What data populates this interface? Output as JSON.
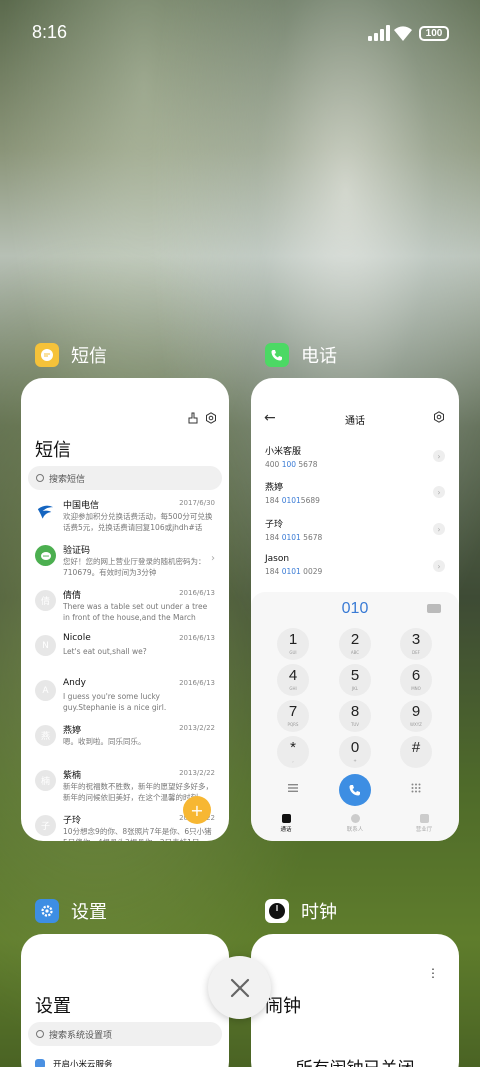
{
  "status_bar": {
    "time": "8:16",
    "battery": "100"
  },
  "apps": [
    {
      "name": "短信",
      "icon": "messages-app-icon",
      "color": "#f5c23a"
    },
    {
      "name": "电话",
      "icon": "phone-app-icon",
      "color": "#4cd964"
    },
    {
      "name": "设置",
      "icon": "settings-app-icon",
      "color": "#3d8ee3"
    },
    {
      "name": "时钟",
      "icon": "clock-app-icon",
      "color": "#111111"
    }
  ],
  "messages": {
    "title": "短信",
    "search_placeholder": "搜索短信",
    "items": [
      {
        "avatar": "",
        "name": "中国电信",
        "date": "2017/6/30",
        "text": "欢迎参加积分兑换话费活动，每500分可兑换话费5元，兑换话费请回复106或jhdh#话费..."
      },
      {
        "avatar": "",
        "name": "验证码",
        "date": "",
        "text": "您好！您的网上营业厅登录的随机密码为：710679。有效时间为3分钟"
      },
      {
        "avatar": "倩",
        "name": "倩倩",
        "date": "2016/6/13",
        "text": "There was a table set out under a tree in front of the house,and the March Hare an..."
      },
      {
        "avatar": "N",
        "name": "Nicole",
        "date": "2016/6/13",
        "text": "Let's eat out,shall we?"
      },
      {
        "avatar": "A",
        "name": "Andy",
        "date": "2016/6/13",
        "text": "I guess you're some lucky guy.Stephanie is a nice girl."
      },
      {
        "avatar": "燕",
        "name": "燕婷",
        "date": "2013/2/22",
        "text": "嗯。收到啦。同乐同乐。"
      },
      {
        "avatar": "楠",
        "name": "紫楠",
        "date": "2013/2/22",
        "text": "新年的祝福数不胜数，新年的愿望好多好多，新年的问候依旧美好，在这个温馨的时刻..."
      },
      {
        "avatar": "子",
        "name": "子玲",
        "date": "2013/2/22",
        "text": "10分想念9的你、8张照片7年是你、6只小猪5只傻你、4根骨头3根骨你、2只青蛙1只..."
      }
    ]
  },
  "phone": {
    "title": "通话",
    "calls": [
      {
        "name": "小米客服",
        "num_pre": "400 ",
        "num_hl": "100",
        "num_post": " 5678"
      },
      {
        "name": "燕婷",
        "num_pre": "184 ",
        "num_hl": "0101",
        "num_post": "5689"
      },
      {
        "name": "子玲",
        "num_pre": "184 ",
        "num_hl": "0101",
        "num_post": " 5678"
      },
      {
        "name": "Jason",
        "num_pre": "184 ",
        "num_hl": "0101",
        "num_post": " 0029"
      }
    ],
    "dial_display": "010",
    "keys": [
      {
        "d": "1",
        "l": "GUI"
      },
      {
        "d": "2",
        "l": "ABC"
      },
      {
        "d": "3",
        "l": "DEF"
      },
      {
        "d": "4",
        "l": "GHI"
      },
      {
        "d": "5",
        "l": "JKL"
      },
      {
        "d": "6",
        "l": "MNO"
      },
      {
        "d": "7",
        "l": "PQRS"
      },
      {
        "d": "8",
        "l": "TUV"
      },
      {
        "d": "9",
        "l": "WXYZ"
      },
      {
        "d": "*",
        "l": ","
      },
      {
        "d": "0",
        "l": "+"
      },
      {
        "d": "#",
        "l": ""
      }
    ],
    "tabs": [
      "通话",
      "联系人",
      "营业厅"
    ]
  },
  "settings": {
    "title": "设置",
    "search_placeholder": "搜索系统设置项",
    "first_item": "开启小米云服务"
  },
  "clock": {
    "title": "闹钟",
    "empty_text": "所有闹钟已关闭"
  }
}
